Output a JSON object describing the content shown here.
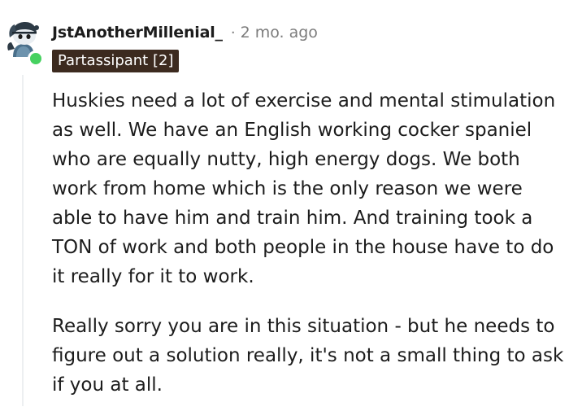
{
  "comment": {
    "author": "JstAnotherMillenial_",
    "separator": "·",
    "timestamp": "2 mo. ago",
    "flair": "Partassipant [2]",
    "paragraphs": [
      "Huskies need a lot of exercise and mental stimulation as well. We have an English working cocker spaniel who are equally nutty, high energy dogs. We both work from home which is the only reason we were able to have him and train him. And training took a TON of work and both people in the house have to do it really for it to work.",
      "Really sorry you are in this situation - but he needs to figure out a solution really, it's not a small thing to ask if you at all."
    ],
    "avatar_icon": "snoo-avatar-icon",
    "online_status_color": "#46d160",
    "flair_background": "#3c2a1f"
  }
}
